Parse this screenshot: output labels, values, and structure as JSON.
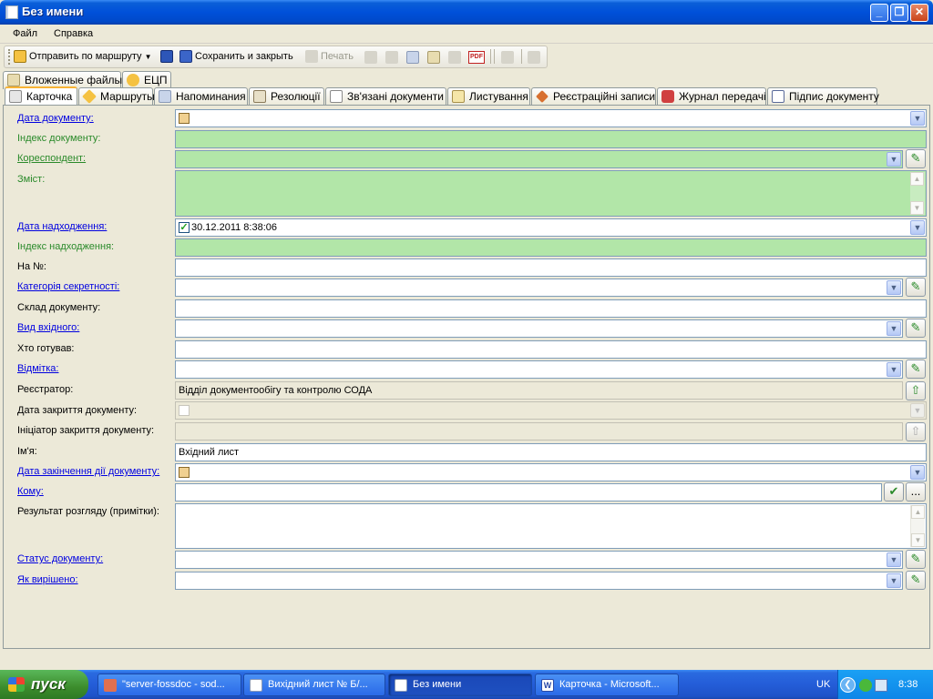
{
  "window": {
    "title": "Без имени"
  },
  "menu": [
    "Файл",
    "Справка"
  ],
  "toolbar": {
    "send": "Отправить по маршруту",
    "save_close": "Сохранить и закрыть",
    "print": "Печать"
  },
  "tabs_top": [
    "Вложенные файлы",
    "ЕЦП"
  ],
  "tabs": [
    "Карточка",
    "Маршруты",
    "Напоминания",
    "Резолюції",
    "Зв'язані документи",
    "Листування",
    "Реєстраційні записи",
    "Журнал передачі",
    "Підпис документу"
  ],
  "form": {
    "doc_date": "Дата документу:",
    "doc_index": "Індекс документу:",
    "correspondent": "Кореспондент:",
    "content": "Зміст:",
    "receipt_date": "Дата надходження:",
    "receipt_date_value": "30.12.2011    8:38:06",
    "receipt_index": "Індекс надходження:",
    "to_number": "На №:",
    "secrecy": "Категорія секретності:",
    "composition": "Склад документу:",
    "incoming_type": "Вид вхідного:",
    "prepared_by": "Хто готував:",
    "mark": "Відмітка:",
    "registrar": "Реєстратор:",
    "registrar_value": "Відділ документообігу та контролю СОДА",
    "close_date": "Дата закриття документу:",
    "close_initiator": "Ініціатор закриття документу:",
    "name": "Ім'я:",
    "name_value": "Вхідний лист",
    "validity_end": "Дата закінчення дії документу:",
    "to_whom": "Кому:",
    "review_result": "Результат розгляду (примітки):",
    "doc_status": "Статус документу:",
    "how_resolved": "Як вирішено:"
  },
  "taskbar": {
    "start": "пуск",
    "tasks": [
      "\"server-fossdoc - sod...",
      "Вихідний лист № Б/...",
      "Без имени",
      "Карточка - Microsoft..."
    ],
    "lang": "UK",
    "clock": "8:38"
  },
  "colors": {
    "required_field": "#b2e6a8",
    "link_label": "#0000e0",
    "green_label": "#2a8a2a"
  }
}
